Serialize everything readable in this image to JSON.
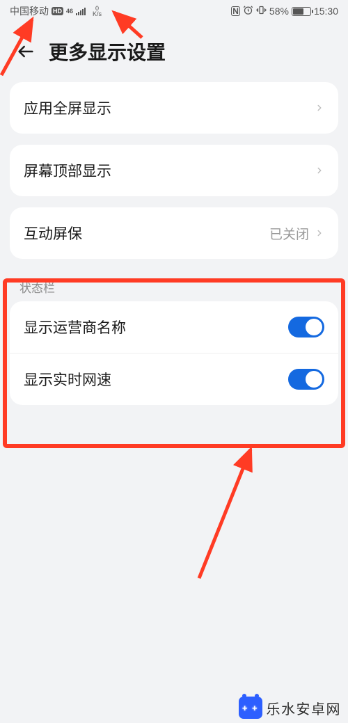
{
  "status_bar": {
    "carrier": "中国移动",
    "hd_badge": "HD",
    "net_gen": "46",
    "netspeed_value": "0",
    "netspeed_unit": "K/s",
    "nfc": "N",
    "battery_pct": "58%",
    "time": "15:30"
  },
  "header": {
    "title": "更多显示设置"
  },
  "rows": {
    "fullscreen": {
      "label": "应用全屏显示"
    },
    "top_display": {
      "label": "屏幕顶部显示"
    },
    "screensaver": {
      "label": "互动屏保",
      "value": "已关闭"
    }
  },
  "section": {
    "status_bar_header": "状态栏",
    "show_carrier": {
      "label": "显示运营商名称",
      "on": true
    },
    "show_netspeed": {
      "label": "显示实时网速",
      "on": true
    }
  },
  "watermark": {
    "text": "乐水安卓网"
  },
  "colors": {
    "accent": "#1469e0",
    "annotation": "#ff3b24"
  }
}
